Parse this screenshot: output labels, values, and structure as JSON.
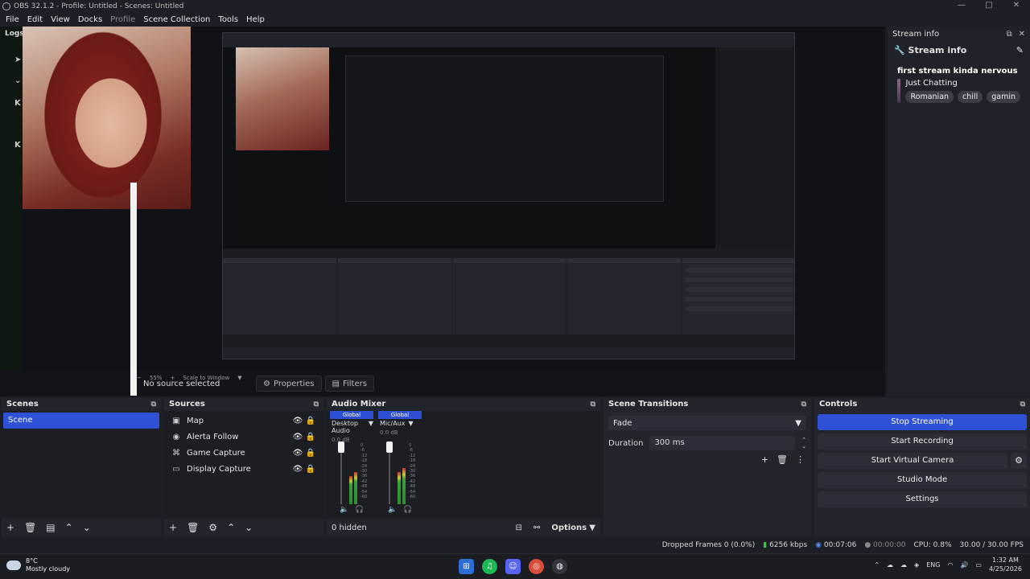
{
  "window": {
    "title": "OBS 32.1.2 - Profile: Untitled - Scenes: Untitled",
    "controls": [
      "—",
      "□",
      "✕"
    ]
  },
  "menu": [
    "File",
    "Edit",
    "View",
    "Docks",
    "Profile",
    "Scene Collection",
    "Tools",
    "Help"
  ],
  "preview": {
    "logs_label": "Logs",
    "zoom": "55%",
    "scale_mode": "Scale to Window"
  },
  "source_toolbar": {
    "no_source": "No source selected",
    "properties": "Properties",
    "filters": "Filters"
  },
  "stream_info": {
    "dock_title": "Stream info",
    "header": "Stream info",
    "stream_title": "first stream kinda nervous",
    "category": "Just Chatting",
    "tags": [
      "Romanian",
      "chill",
      "gamin"
    ]
  },
  "scenes": {
    "title": "Scenes",
    "items": [
      "Scene"
    ]
  },
  "sources": {
    "title": "Sources",
    "items": [
      {
        "label": "Map",
        "icon": "map-icon"
      },
      {
        "label": "Alerta Follow",
        "icon": "browser-icon"
      },
      {
        "label": "Game Capture",
        "icon": "gamepad-icon"
      },
      {
        "label": "Display Capture",
        "icon": "monitor-icon"
      }
    ]
  },
  "audio_mixer": {
    "title": "Audio Mixer",
    "channels": [
      {
        "group": "Global",
        "name": "Desktop Audio",
        "db": "0.0 dB",
        "level_l": 0.55,
        "level_r": 0.62
      },
      {
        "group": "Global",
        "name": "Mic/Aux",
        "db": "0.0 dB",
        "level_l": 0.62,
        "level_r": 0.7
      }
    ],
    "hidden": "0 hidden",
    "options": "Options",
    "ticks": [
      "0",
      "-6",
      "-12",
      "-18",
      "-24",
      "-30",
      "-36",
      "-42",
      "-48",
      "-54",
      "-60"
    ]
  },
  "scene_transitions": {
    "title": "Scene Transitions",
    "transition": "Fade",
    "duration_label": "Duration",
    "duration_value": "300 ms"
  },
  "controls": {
    "title": "Controls",
    "stop_streaming": "Stop Streaming",
    "start_recording": "Start Recording",
    "start_virtual_camera": "Start Virtual Camera",
    "studio_mode": "Studio Mode",
    "settings": "Settings"
  },
  "status": {
    "dropped": "Dropped Frames 0 (0.0%)",
    "bitrate": "6256 kbps",
    "stream_time": "00:07:06",
    "rec_time": "00:00:00",
    "cpu": "CPU: 0.8%",
    "fps": "30.00 / 30.00 FPS"
  },
  "taskbar": {
    "weather_temp": "8°C",
    "weather_desc": "Mostly cloudy",
    "lang": "ENG",
    "time": "1:32 AM",
    "date": "4/25/2026"
  }
}
